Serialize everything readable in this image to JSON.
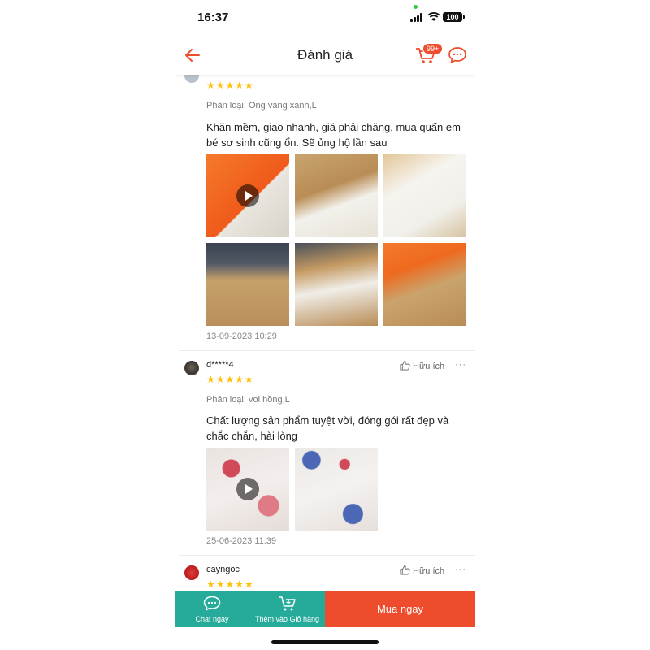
{
  "status_bar": {
    "time": "16:37",
    "battery": "100"
  },
  "header": {
    "title": "Đánh giá",
    "cart_badge": "99+"
  },
  "reviews": [
    {
      "username": "",
      "stars": "★★★★★",
      "variant": "Phân loại: Ong vàng xanh,L",
      "comment": "Khăn mềm, giao nhanh, giá phải chăng, mua quấn em bé sơ sinh cũng ổn. Sẽ ủng hộ lần sau",
      "date": "13-09-2023 10:29",
      "media_count": 6
    },
    {
      "username": "d*****4",
      "helpful": "Hữu ích",
      "more": "···",
      "stars": "★★★★★",
      "variant": "Phân loại: voi hồng,L",
      "comment": "Chất lượng sản phẩm tuyệt vời, đóng gói rất đẹp và chắc chắn, hài lòng",
      "date": "25-06-2023 11:39",
      "media_count": 2
    },
    {
      "username": "cayngoc",
      "helpful": "Hữu ích",
      "more": "···",
      "stars": "★★★★★"
    }
  ],
  "bottom_bar": {
    "chat_label": "Chat ngay",
    "cart_label": "Thêm vào Giỏ hàng",
    "buy_label": "Mua ngay"
  },
  "colors": {
    "accent": "#ee4d2d",
    "teal": "#26aa99",
    "star": "#ffc107"
  },
  "icons": [
    "back-arrow-icon",
    "cart-icon",
    "chat-icon",
    "thumbs-up-icon",
    "play-icon",
    "chat-bubble-icon",
    "add-to-cart-icon"
  ]
}
